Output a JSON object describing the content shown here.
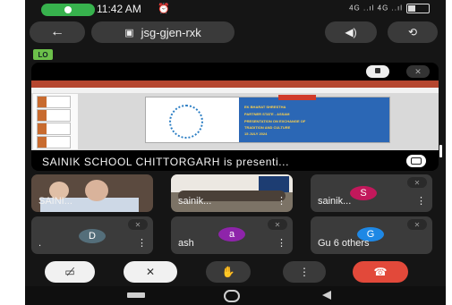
{
  "status_bar": {
    "time": "11:42 AM",
    "time_icon": "alarm-icon",
    "right_icons": "4G ..ıl 4G ..ıl",
    "battery_icon": "battery-icon",
    "call_indicator_icon": "ongoing-call-icon"
  },
  "top_bar": {
    "back_icon": "arrow-left-icon",
    "meeting_code": "jsg-gjen-rxk",
    "meeting_icon": "calendar-icon",
    "audio_icon": "speaker-icon",
    "switch_camera_icon": "switch-camera-icon"
  },
  "live_badge": "LO",
  "presentation": {
    "caption": "SAINIK SCHOOL CHITTORGARH is presenti...",
    "pin_icon": "pin-icon",
    "mic_icon": "mic-off-icon",
    "expand_icon": "expand-icon",
    "slide_lines": [
      "EK BHARAT SHRESTHA",
      "PARTNER STATE - ASSAM",
      "PRESENTATION ON EXCHANGE OF",
      "TRADITION AND CULTURE",
      "15 JULY 2024"
    ]
  },
  "participants": [
    {
      "name": "SAINI...",
      "type": "video",
      "more": "⋮",
      "mute_icon": "mic-off-icon"
    },
    {
      "name": "sainik...",
      "type": "video",
      "more": "⋮",
      "mute_icon": "mic-off-icon"
    },
    {
      "name": "sainik...",
      "type": "avatar",
      "initial": "S",
      "avatar_color": "#c2185b",
      "more": "⋮",
      "mute_icon": "mic-off-icon"
    },
    {
      "name": ".",
      "type": "avatar",
      "initial": "D",
      "avatar_color": "#546e7a",
      "more": "⋮",
      "mute_icon": "mic-off-icon"
    },
    {
      "name": "ash",
      "type": "avatar",
      "initial": "a",
      "avatar_color": "#8e24aa",
      "more": "⋮",
      "mute_icon": "mic-off-icon"
    },
    {
      "name": "Gu 6 others",
      "type": "avatar",
      "initial": "G",
      "avatar_color": "#1e88e5",
      "more": "",
      "mute_icon": "mic-off-icon"
    }
  ],
  "controls": {
    "camera_icon": "camera-off-icon",
    "mic_icon": "mic-off-icon",
    "hand_icon": "raise-hand-icon",
    "more": "⋮",
    "leave_icon": "end-call-icon"
  },
  "colors": {
    "leave": "#e2493a",
    "live_badge": "#6cc04a",
    "call_pill": "#37b24d"
  }
}
